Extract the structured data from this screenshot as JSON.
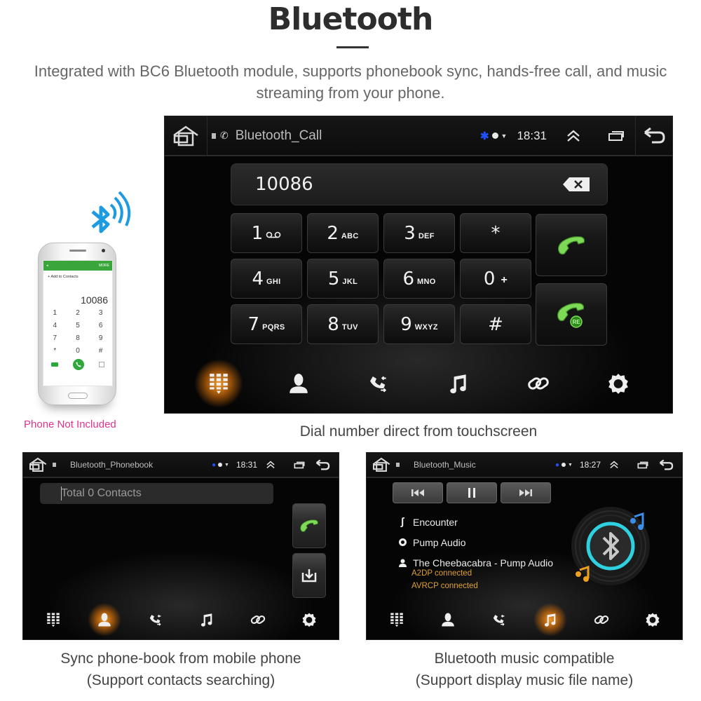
{
  "header": {
    "title": "Bluetooth",
    "subtitle": "Integrated with BC6 Bluetooth module, supports phonebook sync, hands-free call, and music streaming from your phone."
  },
  "phone_illustration": {
    "app_bar_right": "MORE",
    "add_to_contacts": "Add to Contacts",
    "number": "10086",
    "keys": [
      "1",
      "2",
      "3",
      "4",
      "5",
      "6",
      "7",
      "8",
      "9",
      "*",
      "0",
      "#"
    ],
    "note": "Phone Not Included",
    "note_color": "#e2328d"
  },
  "main_screen": {
    "status_bar": {
      "title": "Bluetooth_Call",
      "time": "18:31",
      "icons": [
        "home-icon",
        "sd-card-icon",
        "phone-icon",
        "bluetooth-icon",
        "circle-icon",
        "wifi-icon",
        "collapse-icon",
        "recent-apps-icon",
        "back-icon"
      ]
    },
    "dial_number": "10086",
    "keypad": [
      {
        "digit": "1",
        "letters": "voicemail"
      },
      {
        "digit": "2",
        "letters": "ABC"
      },
      {
        "digit": "3",
        "letters": "DEF"
      },
      {
        "digit": "*",
        "letters": ""
      },
      {
        "digit": "4",
        "letters": "GHI"
      },
      {
        "digit": "5",
        "letters": "JKL"
      },
      {
        "digit": "6",
        "letters": "MNO"
      },
      {
        "digit": "0",
        "letters": "+"
      },
      {
        "digit": "7",
        "letters": "PQRS"
      },
      {
        "digit": "8",
        "letters": "TUV"
      },
      {
        "digit": "9",
        "letters": "WXYZ"
      },
      {
        "digit": "#",
        "letters": ""
      }
    ],
    "call_buttons": [
      "call-icon",
      "redial-icon"
    ],
    "redial_badge": "RE",
    "bottom_nav": [
      {
        "name": "dialpad",
        "active": true
      },
      {
        "name": "contacts",
        "active": false
      },
      {
        "name": "call-log",
        "active": false
      },
      {
        "name": "music",
        "active": false
      },
      {
        "name": "pairing",
        "active": false
      },
      {
        "name": "settings",
        "active": false
      }
    ],
    "caption": "Dial number direct from touchscreen"
  },
  "phonebook_screen": {
    "status_bar": {
      "title": "Bluetooth_Phonebook",
      "time": "18:31"
    },
    "search_placeholder": "Total 0 Contacts",
    "side_buttons": [
      "call-icon",
      "download-contacts-icon"
    ],
    "active_nav": "contacts",
    "caption_line1": "Sync phone-book from mobile phone",
    "caption_line2": "(Support contacts searching)"
  },
  "music_screen": {
    "status_bar": {
      "title": "Bluetooth_Music",
      "time": "18:27"
    },
    "controls": [
      "previous-icon",
      "pause-icon",
      "next-icon"
    ],
    "track": {
      "title": "Encounter",
      "album": "Pump Audio",
      "artist": "The Cheebacabra - Pump Audio"
    },
    "connection": [
      "A2DP connected",
      "AVRCP connected"
    ],
    "connection_color": "#e0a030",
    "active_nav": "music",
    "caption_line1": "Bluetooth music compatible",
    "caption_line2": "(Support display music file name)"
  },
  "colors": {
    "active_glow": "#f5a020",
    "call_green": "#7ed957",
    "bluetooth_blue": "#1f4fff",
    "disc_ring": "#2fd0e0"
  }
}
